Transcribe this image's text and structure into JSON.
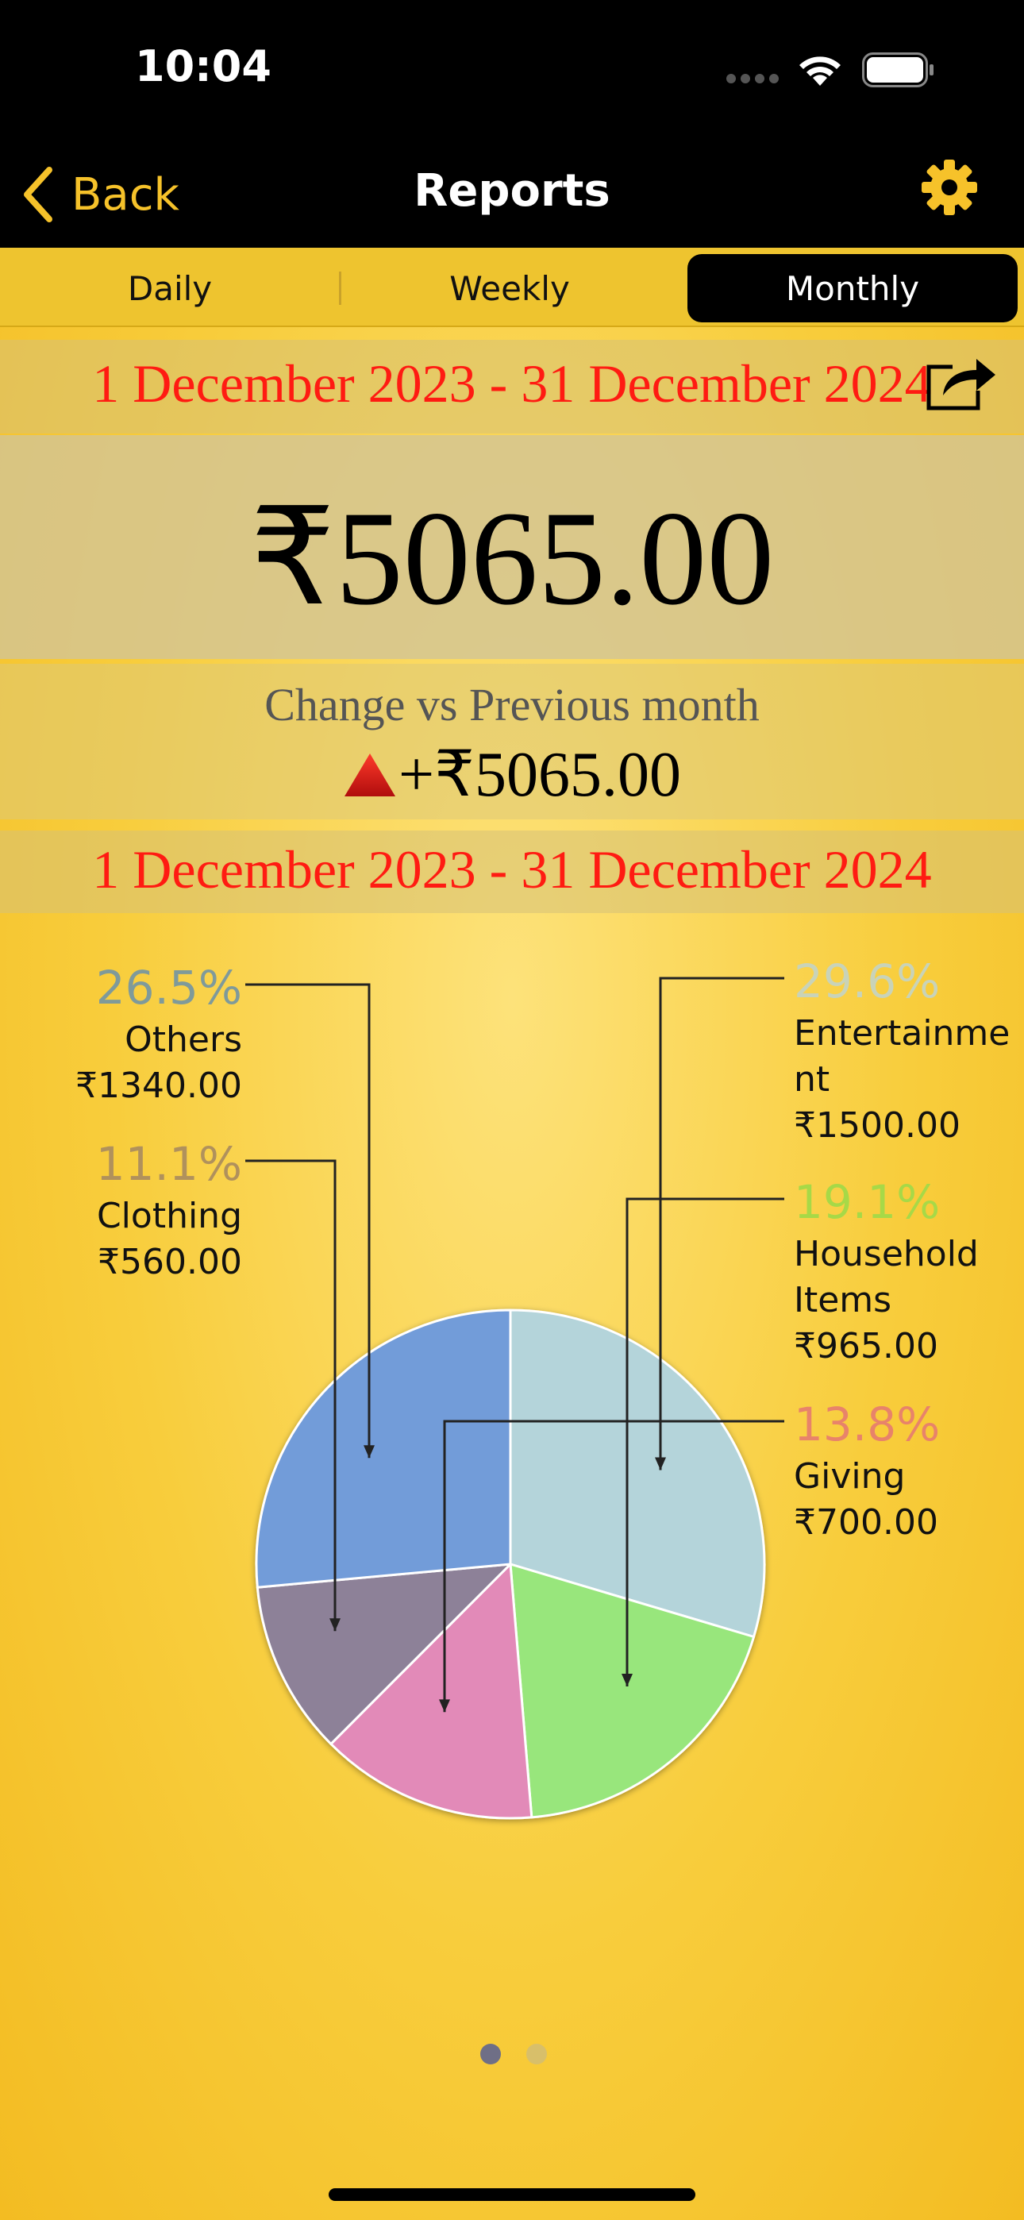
{
  "status": {
    "time": "10:04"
  },
  "nav": {
    "back_label": "Back",
    "title": "Reports"
  },
  "icons": {
    "back": "chevron-left-icon",
    "settings": "gear-icon",
    "share": "share-icon",
    "change": "triangle-up-icon"
  },
  "tabs": [
    {
      "label": "Daily",
      "selected": false
    },
    {
      "label": "Weekly",
      "selected": false
    },
    {
      "label": "Monthly",
      "selected": true
    }
  ],
  "report": {
    "date_range": "1 December 2023 - 31 December 2024",
    "total": "₹5065.00",
    "change_label": "Change vs Previous month",
    "change_value": "+₹5065.00",
    "chart_date_range": "1 December 2023 - 31 December 2024"
  },
  "chart_data": {
    "type": "pie",
    "slices": [
      {
        "name": "Entertainment",
        "label_lines": [
          "Entertainme",
          "nt"
        ],
        "value": 1500.0,
        "amount": "₹1500.00",
        "percent": "29.6%",
        "color": "#b4d4da",
        "label_color": "#c9d3b8"
      },
      {
        "name": "Household Items",
        "label_lines": [
          "Household",
          "Items"
        ],
        "value": 965.0,
        "amount": "₹965.00",
        "percent": "19.1%",
        "color": "#98e67c",
        "label_color": "#a7d947"
      },
      {
        "name": "Giving",
        "label_lines": [
          "Giving"
        ],
        "value": 700.0,
        "amount": "₹700.00",
        "percent": "13.8%",
        "color": "#e28ab8",
        "label_color": "#e8836a"
      },
      {
        "name": "Clothing",
        "label_lines": [
          "Clothing"
        ],
        "value": 560.0,
        "amount": "₹560.00",
        "percent": "11.1%",
        "color": "#8d8198",
        "label_color": "#b0915c"
      },
      {
        "name": "Others",
        "label_lines": [
          "Others"
        ],
        "value": 1340.0,
        "amount": "₹1340.00",
        "percent": "26.5%",
        "color": "#729cd9",
        "label_color": "#7f9a9a"
      }
    ]
  },
  "pager": {
    "pages": 2,
    "current": 1
  },
  "colors": {
    "accent": "#f6c22a",
    "date_red": "#ff1b12",
    "change_up": "#e11b1b"
  }
}
